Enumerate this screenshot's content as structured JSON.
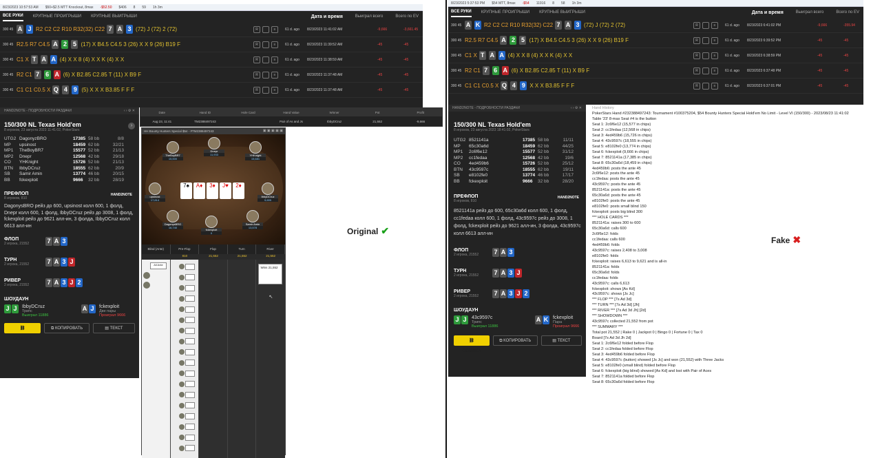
{
  "left_top": {
    "strip": [
      "8/23/2023 10:57:53 AM",
      "$50+$2.5 MTT Knockout, 8max",
      "-$52.50",
      "$406",
      "8",
      "59",
      "1h 3m"
    ],
    "tabs": [
      "ВСЕ РУКИ",
      "КРУПНЫЕ ПРОИГРЫШИ",
      "КРУПНЫЕ ВЫИГРЫШИ"
    ],
    "col_date": "Дата и время",
    "col_won": "Выиграл всего",
    "col_ev": "Всего по EV"
  },
  "right_top": {
    "strip": [
      "8/23/2023 5:37:53 PM",
      "$54 MTT, 8max",
      "-$54",
      "11916",
      "8",
      "58",
      "1h 3m"
    ],
    "tabs": [
      "ВСЕ РУКИ",
      "КРУПНЫЕ ПРОИГРЫШИ",
      "КРУПНЫЕ ВЫИГРЫШИ"
    ],
    "col_date": "Дата и время",
    "col_won": "Выиграл всего",
    "col_ev": "Всего по EV"
  },
  "left_rows": [
    {
      "stakes": "300 45",
      "hole": [
        [
          "A",
          "s"
        ],
        [
          "J",
          "d"
        ]
      ],
      "actions": "R2 C2 C2 R10 R32(32) C22",
      "board": [
        [
          "7",
          "s"
        ],
        [
          "A",
          "s"
        ],
        [
          "3",
          "d"
        ]
      ],
      "extra": "(72) J (72) 2 (72)",
      "ago": "61 d. ago",
      "date": "8/23/2023 11:41:02 AM",
      "won": "-9,666",
      "ev": "-3,661.45"
    },
    {
      "stakes": "300 45",
      "hole": [],
      "actions": "R2.5 R7 C4.5",
      "board": [
        [
          "A",
          "s"
        ],
        [
          "2",
          "c"
        ],
        [
          "5",
          "s"
        ]
      ],
      "extra": "(17) X B4.5 C4.5 3 (26) X X 9 (26) B19 F",
      "ago": "61 d. ago",
      "date": "8/23/2023 11:39:52 AM",
      "won": "-45",
      "ev": "-45"
    },
    {
      "stakes": "300 45",
      "hole": [],
      "actions": "C1 X",
      "board": [
        [
          "T",
          "s"
        ],
        [
          "A",
          "s"
        ],
        [
          "A",
          "d"
        ]
      ],
      "extra": "(4) X X 8 (4) X X K (4) X X",
      "ago": "61 d. ago",
      "date": "8/23/2023 11:38:59 AM",
      "won": "-45",
      "ev": "-45"
    },
    {
      "stakes": "300 45",
      "hole": [],
      "actions": "R2 C1",
      "board": [
        [
          "7",
          "s"
        ],
        [
          "6",
          "c"
        ],
        [
          "A",
          "h"
        ]
      ],
      "extra": "(6) X B2.85 C2.85 T (11) X B9 F",
      "ago": "61 d. ago",
      "date": "8/23/2023 11:37:48 AM",
      "won": "-45",
      "ev": "-45"
    },
    {
      "stakes": "300 45",
      "hole": [],
      "actions": "C1 C1 C0.5 X",
      "board": [
        [
          "Q",
          "s"
        ],
        [
          "4",
          "s"
        ],
        [
          "9",
          "d"
        ]
      ],
      "extra": "(5) X X X B3.85 F F F",
      "ago": "61 d. ago",
      "date": "8/23/2023 11:37:48 AM",
      "won": "-45",
      "ev": "-45"
    }
  ],
  "right_rows": [
    {
      "stakes": "300 45",
      "hole": [
        [
          "A",
          "s"
        ],
        [
          "K",
          "d"
        ]
      ],
      "actions": "R2 C2 C2 R10 R32(32) C22",
      "board": [
        [
          "7",
          "s"
        ],
        [
          "A",
          "s"
        ],
        [
          "3",
          "d"
        ]
      ],
      "extra": "(72) J (72) 2 (72)",
      "ago": "61 d. ago",
      "date": "8/23/2023 6:41:02 PM",
      "won": "-9,666",
      "ev": "-355.94"
    },
    {
      "stakes": "300 45",
      "hole": [],
      "actions": "R2.5 R7 C4.5",
      "board": [
        [
          "A",
          "s"
        ],
        [
          "2",
          "c"
        ],
        [
          "5",
          "s"
        ]
      ],
      "extra": "(17) X B4.5 C4.5 3 (26) X X 9 (26) B19 F",
      "ago": "61 d. ago",
      "date": "8/23/2023 6:39:52 PM",
      "won": "-45",
      "ev": "-45"
    },
    {
      "stakes": "300 45",
      "hole": [],
      "actions": "C1 X",
      "board": [
        [
          "T",
          "s"
        ],
        [
          "A",
          "s"
        ],
        [
          "A",
          "d"
        ]
      ],
      "extra": "(4) X X 8 (4) X X K (4) X X",
      "ago": "61 d. ago",
      "date": "8/23/2023 6:38:59 PM",
      "won": "-45",
      "ev": "-45"
    },
    {
      "stakes": "300 45",
      "hole": [],
      "actions": "R2 C1",
      "board": [
        [
          "7",
          "s"
        ],
        [
          "6",
          "c"
        ],
        [
          "A",
          "h"
        ]
      ],
      "extra": "(6) X B2.85 C2.85 T (11) X B9 F",
      "ago": "61 d. ago",
      "date": "8/23/2023 6:37:48 PM",
      "won": "-45",
      "ev": "-45"
    },
    {
      "stakes": "300 45",
      "hole": [],
      "actions": "C1 C1 C0.5 X",
      "board": [
        [
          "Q",
          "s"
        ],
        [
          "4",
          "s"
        ],
        [
          "9",
          "d"
        ]
      ],
      "extra": "X X X B3.85 F F F",
      "ago": "61 d. ago",
      "date": "8/23/2023 6:37:01 PM",
      "won": "-45",
      "ev": "-45"
    }
  ],
  "left_detail": {
    "header": "HAND2NOTE - ПОДРОБНОСТИ РАЗДАЧИ",
    "title": "150/300 NL Texas Hold'em",
    "subtitle": "8 игроков, 23 августа 2023 11:41:02, PokerStars",
    "players": [
      {
        "pos": "UTG2",
        "name": "DagonyzBRO",
        "stack": "17385",
        "bb": "58 bb",
        "rank": "8/8"
      },
      {
        "pos": "MP",
        "name": "upsinost",
        "stack": "18459",
        "bb": "62 bb",
        "rank": "32/21"
      },
      {
        "pos": "MP1",
        "name": "TheBoyBR7",
        "stack": "15577",
        "bb": "52 bb",
        "rank": "21/13"
      },
      {
        "pos": "MP2",
        "name": "Dnepr",
        "stack": "12568",
        "bb": "42 bb",
        "rank": "29/18"
      },
      {
        "pos": "CO",
        "name": "YHKnight",
        "stack": "15726",
        "bb": "52 bb",
        "rank": "21/13"
      },
      {
        "pos": "BTN",
        "name": "IbbyDCruz",
        "stack": "18555",
        "bb": "62 bb",
        "rank": "20/9"
      },
      {
        "pos": "SB",
        "name": "Samir Amin",
        "stack": "13774",
        "bb": "46 bb",
        "rank": "20/15"
      },
      {
        "pos": "BB",
        "name": "fckexploit",
        "stack": "9666",
        "bb": "32 bb",
        "rank": "28/19"
      }
    ],
    "preflop_title": "ПРЕФЛОП",
    "preflop_sub": "8 игроков, 810",
    "preflop_text": "DagonysBRO рейз до 600, upsinost колл 600, 1 фолд, Dnepr колл 600, 1 фолд, IbbyDCruz рейз до 3008, 1 фолд, fckexploit рейз до 9621 алл-ин, 3 фолда, IbbyDCruz колл 6613 алл-ин",
    "flop_title": "ФЛОП",
    "flop_sub": "2 игрока, 21552",
    "turn_title": "ТУРН",
    "turn_sub": "2 игрока, 21552",
    "river_title": "РИВЕР",
    "river_sub": "2 игрока, 21552",
    "showdown_title": "ШОУДАУН",
    "w_name": "IbbyDCruz",
    "w_hand": "Трипс",
    "w_result": "Выиграл 11886",
    "l_name": "fckexploit",
    "l_hand": "Две пары",
    "l_result": "Проиграл 9666",
    "btn_link": "ССЫЛКА",
    "btn_copy": "КОПИРОВАТЬ",
    "btn_text": "ТЕКСТ",
    "brand": "HAND2NOTE"
  },
  "right_detail": {
    "header": "HAND2NOTE - ПОДРОБНОСТИ РАЗДАЧИ",
    "title": "150/300 NL Texas Hold'em",
    "subtitle": "8 игроков, 23 августа 2023 18:41:02, PokerStars",
    "players": [
      {
        "pos": "UTG2",
        "name": "8521141a",
        "stack": "17385",
        "bb": "58 bb",
        "rank": "11/11"
      },
      {
        "pos": "MP",
        "name": "65c30a6d",
        "stack": "18459",
        "bb": "62 bb",
        "rank": "44/25"
      },
      {
        "pos": "MP1",
        "name": "2c6f6e12",
        "stack": "15577",
        "bb": "52 bb",
        "rank": "31/12"
      },
      {
        "pos": "MP2",
        "name": "cc1fedaa",
        "stack": "12568",
        "bb": "42 bb",
        "rank": "19/6"
      },
      {
        "pos": "CO",
        "name": "4ed459b6",
        "stack": "15726",
        "bb": "52 bb",
        "rank": "25/12"
      },
      {
        "pos": "BTN",
        "name": "43c9597c",
        "stack": "18555",
        "bb": "62 bb",
        "rank": "19/11"
      },
      {
        "pos": "SB",
        "name": "e8102fe0",
        "stack": "13774",
        "bb": "46 bb",
        "rank": "17/17"
      },
      {
        "pos": "BB",
        "name": "fckexploit",
        "stack": "9666",
        "bb": "32 bb",
        "rank": "28/20"
      }
    ],
    "preflop_title": "ПРЕФЛОП",
    "preflop_sub": "8 игроков, 810",
    "preflop_text": "8521141a рейз до 600, 65c30a6d колл 600, 1 фолд, cc1fedaa колл 600, 1 фолд, 43c9597c рейз до 3008, 1 фолд, fckexploit рейз до 9621 алл-ин, 3 фолда, 43c9597c колл 6613 алл-ин",
    "flop_title": "ФЛОП",
    "flop_sub": "2 игрока, 21552",
    "turn_title": "ТУРН",
    "turn_sub": "2 игрока, 21552",
    "river_title": "РИВЕР",
    "river_sub": "2 игрока, 21552",
    "showdown_title": "ШОУДАУН",
    "w_name": "43c9597c",
    "w_hand": "Трипс",
    "w_result": "Выиграл 11886",
    "l_name": "fckexploit",
    "l_hand": "Пара",
    "l_result": "Проиграл 9666",
    "btn_link": "ССЫЛКА",
    "btn_copy": "КОПИРОВАТЬ",
    "btn_text": "ТЕКСТ",
    "brand": "HAND2NOTE"
  },
  "replayer": {
    "cols": [
      "Date",
      "Hand ID",
      "Hole Card",
      "Hand Value",
      "Winner",
      "Pot",
      "Profit"
    ],
    "row": [
      "Aug 23, 11:41",
      "TM2388497243",
      "",
      "Pair of As and Js",
      "IbbyDCruz",
      "21,552",
      "-9,666"
    ],
    "title": "HH Bounty Hunters Special $54 - #TM2388497243",
    "streets": [
      "Blind (Ante)",
      "Pre-Flop",
      "Flop",
      "Turn",
      "River"
    ],
    "pots": [
      "810",
      "21,552",
      "21,552",
      "21,552"
    ],
    "win_text": "Wins 21,552",
    "seats": [
      {
        "name": "TheBoyBR7",
        "stack": "15,500"
      },
      {
        "name": "Dnepr",
        "stack": "11,933"
      },
      {
        "name": "YHKnight",
        "stack": "15,681"
      },
      {
        "name": "upsinost",
        "stack": "17,814"
      },
      {
        "name": "IbbyDCruz",
        "stack": "9,699"
      },
      {
        "name": "DagonysBRO",
        "stack": "16,740"
      },
      {
        "name": "fckexploit",
        "stack": "0"
      },
      {
        "name": "Samir Amin",
        "stack": "13,578"
      }
    ]
  },
  "original_label": "Original",
  "fake_label": "Fake",
  "hh_title": "Hand History",
  "hand_history": [
    "PokerStars Hand #232388497243: Tournament #100375204, $54 Bounty Hunters Special Hold'em No Limit - Level VI (150/300) - 2023/08/23 11:41:02",
    "Table '23' 8-max Seat #4 is the button",
    "Seat 1: 2c6f6e12 (15,577 in chips)",
    "Seat 2: cc1fedaa (12,568 in chips)",
    "Seat 3: 4ed459b6 (15,726 in chips)",
    "Seat 4: 43c9597c (18,555 in chips)",
    "Seat 5: e8102fe0 (13,774 in chips)",
    "Seat 6: fckexploit (9,666 in chips)",
    "Seat 7: 8521141a (17,385 in chips)",
    "Seat 8: 65c30a6d (18,459 in chips)",
    "4ed459b6: posts the ante 45",
    "2c6f6e12: posts the ante 45",
    "cc1fedaa: posts the ante 45",
    "43c9597c: posts the ante 45",
    "8521141a: posts the ante 45",
    "65c30a6d: posts the ante 45",
    "e8102fe0: posts the ante 45",
    "e8102fe0: posts small blind 150",
    "fckexploit: posts big blind 300",
    "*** HOLE CARDS ***",
    "8521141a: raises 300 to 600",
    "65c30a6d: calls 600",
    "2c6f6e12: folds",
    "cc1fedaa: calls 600",
    "4ed459b6: folds",
    "43c9597c: raises 2,408 to 3,008",
    "e8102fe0: folds",
    "fckexploit: raises 6,613 to 9,621 and is all-in",
    "8521141a: folds",
    "65c30a6d: folds",
    "cc1fedaa: folds",
    "43c9597c: calls 6,613",
    "fckexploit: shows [As Kd]",
    "43c9597c: shows [Js Jc]",
    "*** FLOP *** [7s Ad 3d]",
    "*** TURN *** [7s Ad 3d] [Jh]",
    "*** RIVER *** [7s Ad 3d Jh] [2d]",
    "*** SHOWDOWN ***",
    "43c9597c collected 21,552 from pot",
    "*** SUMMARY ***",
    "Total pot 21,552 | Rake 0 | Jackpot 0 | Bingo 0 | Fortune 0 | Tax 0",
    "Board [7s Ad 3d Jh 2d]",
    "Seat 1: 2c6f6e12 folded before Flop",
    "Seat 2: cc1fedaa folded before Flop",
    "Seat 3: 4ed459b6 folded before Flop",
    "Seat 4: 43c9597c (button) showed [Js Jc] and won (21,552) with Three Jacks",
    "Seat 5: e8102fe0 (small blind) folded before Flop",
    "Seat 6: fckexploit (big blind) showed [As Kd] and lost with Pair of Aces",
    "Seat 7: 8521141a folded before Flop",
    "Seat 8: 65c30a6d folded before Flop"
  ]
}
